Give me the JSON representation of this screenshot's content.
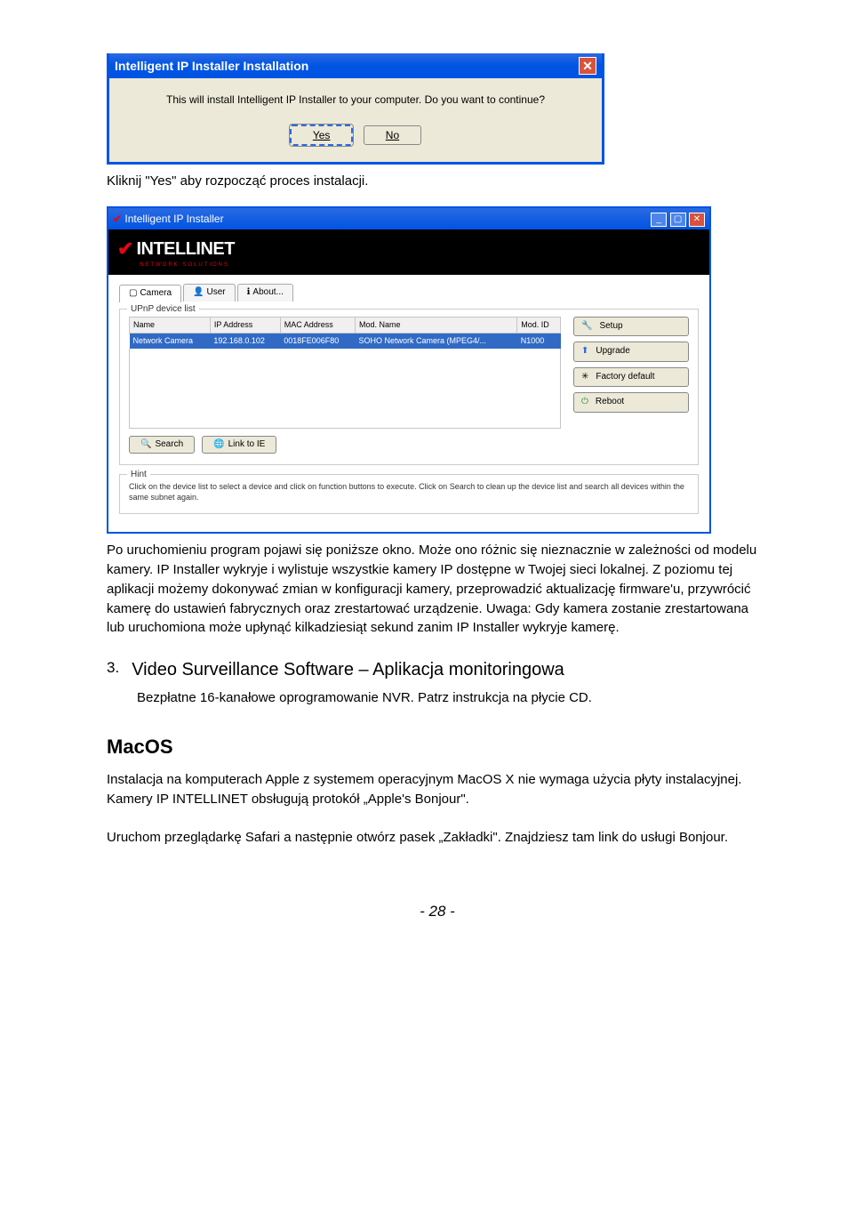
{
  "dialog": {
    "title": "Intelligent IP Installer Installation",
    "message": "This will install Intelligent IP Installer to your computer. Do you want to continue?",
    "yes": "Yes",
    "no": "No"
  },
  "caption1": "Kliknij \"Yes\" aby rozpocząć proces instalacji.",
  "app": {
    "title": "Intelligent IP Installer",
    "brand": "INTELLINET",
    "brand_sub": "NETWORK SOLUTIONS",
    "tabs": {
      "camera": "Camera",
      "user": "User",
      "about": "About..."
    },
    "fieldset_label": "UPnP device list",
    "columns": {
      "name": "Name",
      "ip": "IP Address",
      "mac": "MAC Address",
      "model": "Mod. Name",
      "modid": "Mod. ID"
    },
    "row": {
      "name": "Network Camera",
      "ip": "192.168.0.102",
      "mac": "0018FE006F80",
      "model": "SOHO Network Camera (MPEG4/...",
      "modid": "N1000"
    },
    "buttons": {
      "setup": "Setup",
      "upgrade": "Upgrade",
      "factory": "Factory default",
      "reboot": "Reboot",
      "search": "Search",
      "link": "Link to IE"
    },
    "hint_label": "Hint",
    "hint_text": "Click on the device list to select a device and click on function buttons to execute. Click on Search to clean up the device list and search all devices within the same subnet again."
  },
  "body_text": "Po uruchomieniu program pojawi się poniższe okno. Może ono różnic się nieznacznie w zależności od modelu kamery. IP Installer wykryje i wylistuje wszystkie kamery IP dostępne w Twojej sieci lokalnej. Z poziomu tej aplikacji możemy dokonywać zmian w konfiguracji kamery, przeprowadzić aktualizację firmware'u, przywrócić kamerę do ustawień fabrycznych oraz zrestartować urządzenie. Uwaga: Gdy kamera zostanie zrestartowana lub uruchomiona może upłynąć kilkadziesiąt sekund zanim IP Installer wykryje kamerę.",
  "section3": {
    "num": "3.",
    "title": "Video Surveillance Software – Aplikacja monitoringowa",
    "sub": "Bezpłatne 16-kanałowe oprogramowanie NVR. Patrz instrukcja na płycie CD."
  },
  "macos": {
    "heading": "MacOS",
    "p1": "Instalacja na komputerach Apple z systemem operacyjnym MacOS X nie wymaga użycia płyty instalacyjnej. Kamery IP INTELLINET obsługują protokół „Apple's Bonjour\".",
    "p2": "Uruchom przeglądarkę Safari a następnie otwórz pasek „Zakładki\". Znajdziesz tam link do usługi Bonjour."
  },
  "page_number": "- 28 -"
}
